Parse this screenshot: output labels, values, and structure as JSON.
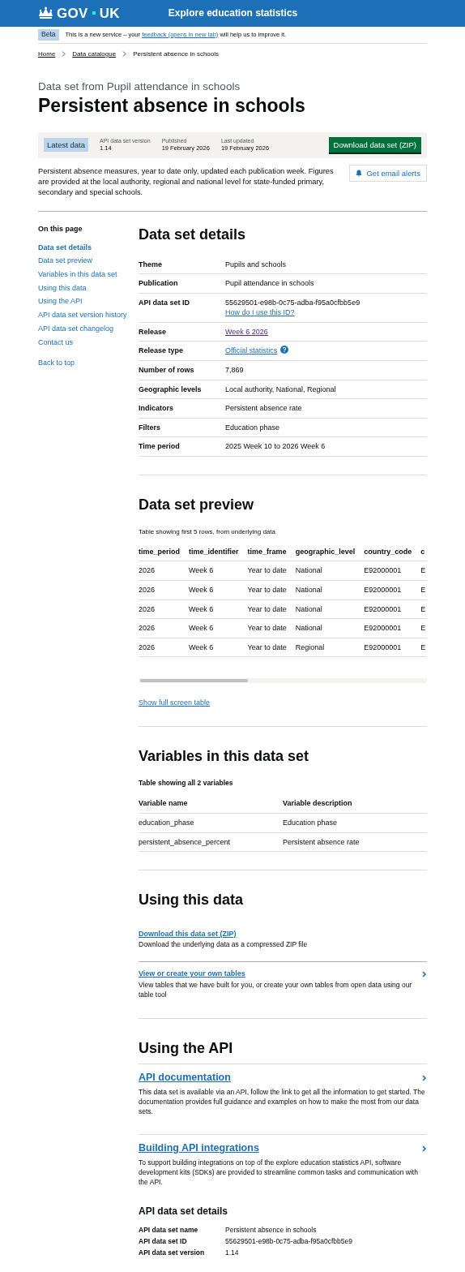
{
  "header": {
    "logo": {
      "left": "GOV",
      "right": "UK"
    },
    "service_name": "Explore education statistics"
  },
  "phase_banner": {
    "tag": "Beta",
    "text_before": "This is a new service – your",
    "link": "feedback (opens in new tab)",
    "text_after": "will help us to improve it."
  },
  "breadcrumbs": [
    {
      "label": "Home",
      "current": false
    },
    {
      "label": "Data catalogue",
      "current": false
    },
    {
      "label": "Persistent absence in schools",
      "current": true
    }
  ],
  "caption": "Data set from Pupil attendance in schools",
  "title": "Persistent absence in schools",
  "summary": {
    "tag": "Latest data",
    "items": [
      {
        "label": "API data set version",
        "value": "1.14"
      },
      {
        "label": "Published",
        "value": "19 February 2026"
      },
      {
        "label": "Last updated",
        "value": "19 February 2026"
      }
    ],
    "button": "Download data set (ZIP)"
  },
  "description": "Persistent absence measures, year to date only, updated each publication week. Figures are provided at the local authority, regional and national level for state-funded primary, secondary and special schools.",
  "alerts_button": "Get email alerts",
  "sidebar": {
    "heading": "On this page",
    "items": [
      {
        "label": "Data set details",
        "selected": true
      },
      {
        "label": "Data set preview",
        "selected": false
      },
      {
        "label": "Variables in this data set",
        "selected": false
      },
      {
        "label": "Using this data",
        "selected": false
      },
      {
        "label": "Using the API",
        "selected": false
      },
      {
        "label": "API data set version history",
        "selected": false
      },
      {
        "label": "API data set changelog",
        "selected": false
      },
      {
        "label": "Contact us",
        "selected": false
      }
    ],
    "back_to_top": "Back to top"
  },
  "details": {
    "heading": "Data set details",
    "rows": [
      {
        "label": "Theme",
        "value": "Pupils and schools",
        "kind": "text"
      },
      {
        "label": "Publication",
        "value": "Pupil attendance in schools",
        "kind": "text"
      },
      {
        "label": "API data set ID",
        "value": "55629501-e98b-0c75-adba-f95a0cfbb5e9",
        "link": "How do I use this ID?",
        "kind": "id"
      },
      {
        "label": "Release",
        "value": "Week 6 2026",
        "kind": "visited_link"
      },
      {
        "label": "Release type",
        "value": "Official statistics",
        "kind": "help_link"
      },
      {
        "label": "Number of rows",
        "value": "7,869",
        "kind": "text"
      },
      {
        "label": "Geographic levels",
        "value": "Local authority, National, Regional",
        "kind": "text"
      },
      {
        "label": "Indicators",
        "value": "Persistent absence rate",
        "kind": "text"
      },
      {
        "label": "Filters",
        "value": "Education phase",
        "kind": "text"
      },
      {
        "label": "Time period",
        "value": "2025 Week 10 to 2026 Week 6",
        "kind": "text"
      }
    ]
  },
  "preview": {
    "heading": "Data set preview",
    "caption": "Table showing first 5 rows, from underlying data",
    "columns": [
      "time_period",
      "time_identifier",
      "time_frame",
      "geographic_level",
      "country_code",
      "c"
    ],
    "rows": [
      [
        "2026",
        "Week 6",
        "Year to date",
        "National",
        "E92000001",
        "E"
      ],
      [
        "2026",
        "Week 6",
        "Year to date",
        "National",
        "E92000001",
        "E"
      ],
      [
        "2026",
        "Week 6",
        "Year to date",
        "National",
        "E92000001",
        "E"
      ],
      [
        "2026",
        "Week 6",
        "Year to date",
        "National",
        "E92000001",
        "E"
      ],
      [
        "2026",
        "Week 6",
        "Year to date",
        "Regional",
        "E92000001",
        "E"
      ]
    ],
    "show_full": "Show full screen table"
  },
  "variables": {
    "heading": "Variables in this data set",
    "caption": "Table showing all 2 variables",
    "columns": [
      "Variable name",
      "Variable description"
    ],
    "rows": [
      [
        "education_phase",
        "Education phase"
      ],
      [
        "persistent_absence_percent",
        "Persistent absence rate"
      ]
    ]
  },
  "using_data": {
    "heading": "Using this data",
    "links": [
      {
        "title": "Download this data set (ZIP)",
        "description": "Download the underlying data as a compressed ZIP file",
        "kind": "plain"
      },
      {
        "title": "View or create your own tables",
        "description": "View tables that we have built for you, or create your own tables from open data using our table tool",
        "kind": "chevron"
      }
    ]
  },
  "using_api": {
    "heading": "Using the API",
    "links": [
      {
        "title": "API documentation",
        "description": "This data set is available via an API, follow the link to get all the information to get started. The documentation provides full guidance and examples on how to make the most from our data sets."
      },
      {
        "title": "Building API integrations",
        "description": "To support building integrations on top of the explore education statistics API, software development kits (SDKs) are provided to streamline common tasks and communication with the API."
      }
    ],
    "details_heading": "API data set details",
    "details": [
      {
        "label": "API data set name",
        "value": "Persistent absence in schools"
      },
      {
        "label": "API data set ID",
        "value": "55629501-e98b-0c75-adba-f95a0cfbb5e9"
      },
      {
        "label": "API data set version",
        "value": "1.14"
      }
    ]
  }
}
